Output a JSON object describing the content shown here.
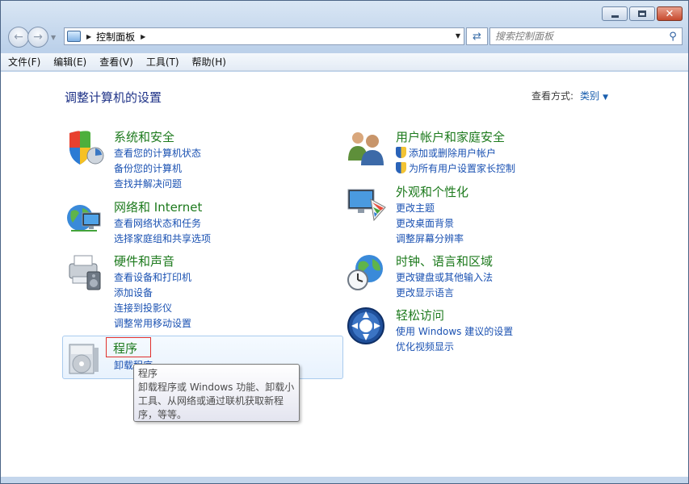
{
  "window": {
    "minimize": "—",
    "maximize": "□",
    "close": "✕"
  },
  "nav": {
    "back_icon": "back-arrow-icon",
    "forward_icon": "forward-arrow-icon",
    "breadcrumb": "控制面板",
    "refresh_icon": "refresh-icon",
    "search_placeholder": "搜索控制面板",
    "search_icon": "search-icon"
  },
  "menu": {
    "items": [
      "文件(F)",
      "编辑(E)",
      "查看(V)",
      "工具(T)",
      "帮助(H)"
    ]
  },
  "main": {
    "heading": "调整计算机的设置",
    "view_by_label": "查看方式:",
    "view_by_value": "类别"
  },
  "categories": {
    "system": {
      "title": "系统和安全",
      "links": [
        "查看您的计算机状态",
        "备份您的计算机",
        "查找并解决问题"
      ]
    },
    "network": {
      "title": "网络和 Internet",
      "links": [
        "查看网络状态和任务",
        "选择家庭组和共享选项"
      ]
    },
    "hardware": {
      "title": "硬件和声音",
      "links": [
        "查看设备和打印机",
        "添加设备",
        "连接到投影仪",
        "调整常用移动设置"
      ]
    },
    "programs": {
      "title": "程序",
      "links": [
        "卸载程序"
      ]
    },
    "users": {
      "title": "用户帐户和家庭安全",
      "links": [
        "添加或删除用户帐户",
        "为所有用户设置家长控制"
      ]
    },
    "appearance": {
      "title": "外观和个性化",
      "links": [
        "更改主题",
        "更改桌面背景",
        "调整屏幕分辨率"
      ]
    },
    "clock": {
      "title": "时钟、语言和区域",
      "links": [
        "更改键盘或其他输入法",
        "更改显示语言"
      ]
    },
    "ease": {
      "title": "轻松访问",
      "links": [
        "使用 Windows 建议的设置",
        "优化视频显示"
      ]
    }
  },
  "tooltip": {
    "title": "程序",
    "line1": "卸载程序或 Windows 功能、卸载小",
    "line2": "工具、从网络或通过联机获取新程",
    "line3": "序，等等。"
  }
}
